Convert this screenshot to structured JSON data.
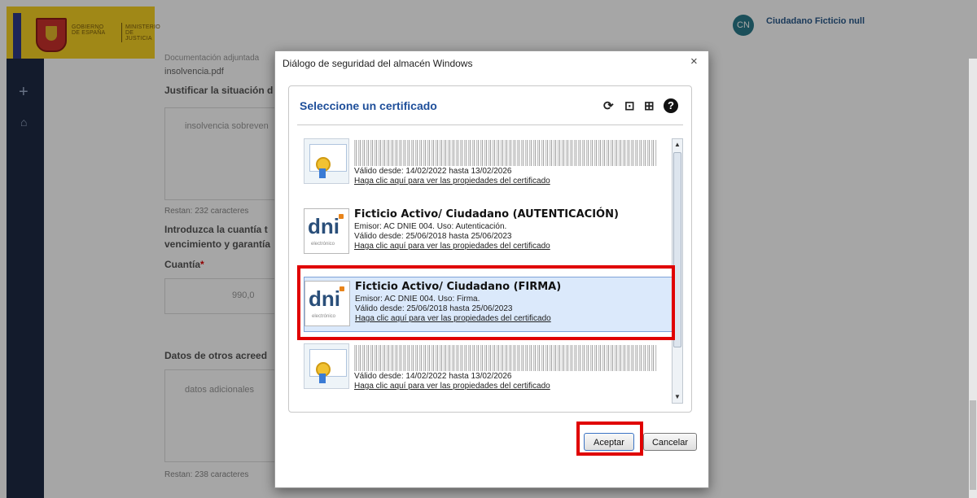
{
  "header": {
    "logo": {
      "gov_line1": "GOBIERNO",
      "gov_line2": "DE ESPAÑA",
      "min_line1": "MINISTERIO",
      "min_line2": "DE JUSTICIA"
    },
    "user": {
      "initials": "CN",
      "name": "Ciudadano Ficticio null"
    }
  },
  "form": {
    "doc_label": "Documentación adjuntada",
    "doc_file": "insolvencia.pdf",
    "justify_label": "Justificar la situación d",
    "justify_value": "insolvencia sobreven",
    "remaining1": "Restan: 232 caracteres",
    "amount_label_1": "Introduzca la cuantía t",
    "amount_label_2": "vencimiento y garantía",
    "cuantia_label": "Cuantía",
    "required_mark": "*",
    "cuantia_value": "990,0",
    "others_label": "Datos de otros acreed",
    "others_placeholder": "datos adicionales",
    "remaining2": "Restan: 238 caracteres"
  },
  "dialog": {
    "title": "Diálogo de seguridad del almacén Windows",
    "close": "×",
    "header": "Seleccione un certificado",
    "tools": [
      "refresh-icon",
      "import-icon",
      "details-icon",
      "help-icon"
    ],
    "certificates": [
      {
        "type": "generic",
        "title": "",
        "issuer": "",
        "validity": "Válido desde: 14/02/2022 hasta 13/02/2026",
        "link": "Haga clic aquí para ver las propiedades del certificado",
        "selected": false
      },
      {
        "type": "dni",
        "title": "Ficticio Activo/ Ciudadano (AUTENTICACIÓN)",
        "issuer": "Emisor: AC DNIE 004. Uso: Autenticación.",
        "validity": "Válido desde: 25/06/2018 hasta 25/06/2023",
        "link": "Haga clic aquí para ver las propiedades del certificado",
        "selected": false
      },
      {
        "type": "dni",
        "title": "Ficticio Activo/ Ciudadano (FIRMA)",
        "issuer": "Emisor: AC DNIE 004. Uso: Firma.",
        "validity": "Válido desde: 25/06/2018 hasta 25/06/2023",
        "link": "Haga clic aquí para ver las propiedades del certificado",
        "selected": true
      },
      {
        "type": "generic",
        "title": "",
        "issuer": "",
        "validity": "Válido desde: 14/02/2022 hasta 13/02/2026",
        "link": "Haga clic aquí para ver las propiedades del certificado",
        "selected": false
      }
    ],
    "dni_icon_text": "dni",
    "dni_icon_sub": "electrónico",
    "accept_label": "Aceptar",
    "cancel_label": "Cancelar"
  }
}
